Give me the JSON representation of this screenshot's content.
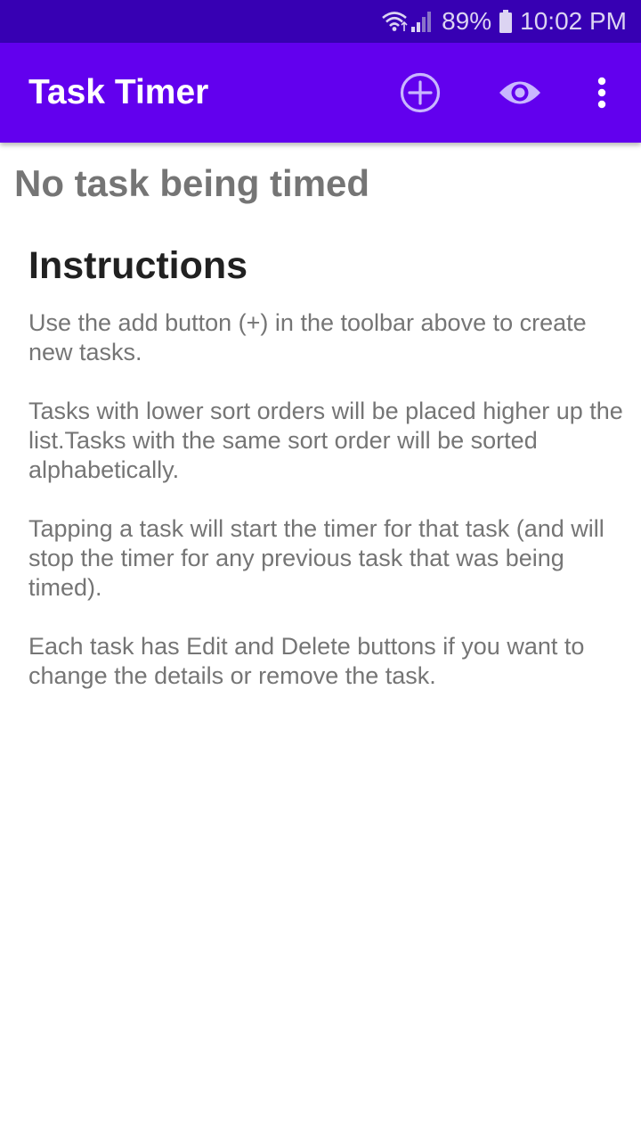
{
  "status_bar": {
    "battery": "89%",
    "time": "10:02 PM"
  },
  "app_bar": {
    "title": "Task Timer",
    "actions": [
      {
        "icon": "add-circle-icon"
      },
      {
        "icon": "eye-icon"
      },
      {
        "icon": "more-vert-icon"
      }
    ]
  },
  "main": {
    "current_task": "No task being timed",
    "instructions": {
      "heading": "Instructions",
      "paragraphs": [
        "Use the add button (+) in the toolbar above to create new tasks.",
        "Tasks with lower sort orders will be placed higher up the list.Tasks with the same sort order will be sorted alphabetically.",
        "Tapping a task will start the timer for that task (and will stop the timer for any previous task that was being timed).",
        "Each task has Edit and Delete buttons if you want to change the details or remove the task."
      ]
    }
  },
  "colors": {
    "status_bar": "#3700b3",
    "app_bar": "#6200ee",
    "icon_tint": "#c9b6ff"
  }
}
